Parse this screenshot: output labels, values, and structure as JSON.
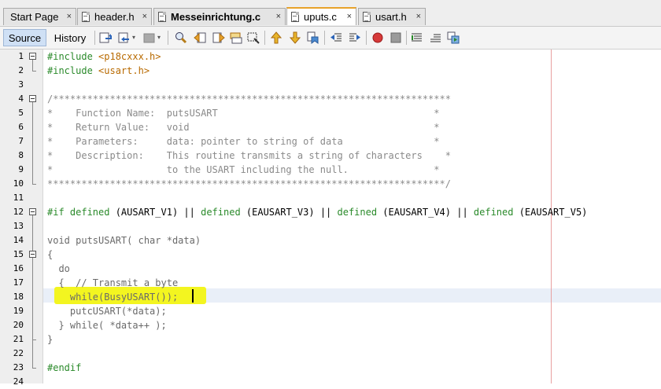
{
  "tabs": [
    {
      "label": "Start Page",
      "active": false,
      "bold": false,
      "icon": "start-page-icon"
    },
    {
      "label": "header.h",
      "active": false,
      "bold": false,
      "icon": "header-file-icon"
    },
    {
      "label": "Messeinrichtung.c",
      "active": false,
      "bold": true,
      "icon": "c-file-icon"
    },
    {
      "label": "uputs.c",
      "active": true,
      "bold": false,
      "icon": "c-file-icon"
    },
    {
      "label": "usart.h",
      "active": false,
      "bold": false,
      "icon": "header-file-icon"
    }
  ],
  "tab_close_glyph": "×",
  "toolbar": {
    "source_label": "Source",
    "history_label": "History",
    "icons": [
      "last-edit-icon",
      "back-icon",
      "forward-icon",
      "find-icon",
      "find-previous-icon",
      "find-next-icon",
      "find-selection-icon",
      "toggle-highlight-icon",
      "previous-bookmark-icon",
      "next-bookmark-icon",
      "toggle-bookmark-icon",
      "shift-left-icon",
      "shift-right-icon",
      "start-macro-icon",
      "stop-macro-icon",
      "comment-icon",
      "uncomment-icon",
      "run-icon"
    ]
  },
  "editor": {
    "line_numbers": [
      "1",
      "2",
      "3",
      "4",
      "5",
      "6",
      "7",
      "8",
      "9",
      "10",
      "11",
      "12",
      "13",
      "14",
      "15",
      "16",
      "17",
      "18",
      "19",
      "20",
      "21",
      "22",
      "23",
      "24"
    ],
    "lines": [
      [
        {
          "t": "#include ",
          "c": "pp"
        },
        {
          "t": "<p18cxxx.h>",
          "c": "str"
        }
      ],
      [
        {
          "t": "#include ",
          "c": "pp"
        },
        {
          "t": "<usart.h>",
          "c": "str"
        }
      ],
      [],
      [
        {
          "t": "/**********************************************************************",
          "c": "cm"
        }
      ],
      [
        {
          "t": "*    Function Name:  putsUSART                                      *",
          "c": "cm"
        }
      ],
      [
        {
          "t": "*    Return Value:   void                                           *",
          "c": "cm"
        }
      ],
      [
        {
          "t": "*    Parameters:     data: pointer to string of data                *",
          "c": "cm"
        }
      ],
      [
        {
          "t": "*    Description:    This routine transmits a string of characters    *",
          "c": "cm"
        }
      ],
      [
        {
          "t": "*                    to the USART including the null.               *",
          "c": "cm"
        }
      ],
      [
        {
          "t": "**********************************************************************/",
          "c": "cm"
        }
      ],
      [],
      [
        {
          "t": "#if ",
          "c": "pp"
        },
        {
          "t": "defined ",
          "c": "kw"
        },
        {
          "t": "(AUSART_V1) ",
          "c": "plain"
        },
        {
          "t": "|| ",
          "c": "plain"
        },
        {
          "t": "defined ",
          "c": "kw"
        },
        {
          "t": "(EAUSART_V3) ",
          "c": "plain"
        },
        {
          "t": "|| ",
          "c": "plain"
        },
        {
          "t": "defined ",
          "c": "kw"
        },
        {
          "t": "(EAUSART_V4) ",
          "c": "plain"
        },
        {
          "t": "|| ",
          "c": "plain"
        },
        {
          "t": "defined ",
          "c": "kw"
        },
        {
          "t": "(EAUSART_V5)",
          "c": "plain"
        }
      ],
      [],
      [
        {
          "t": "void putsUSART( char *data)",
          "c": "gray"
        }
      ],
      [
        {
          "t": "{",
          "c": "gray"
        }
      ],
      [
        {
          "t": "  do",
          "c": "gray"
        }
      ],
      [
        {
          "t": "  {  // Transmit a byte",
          "c": "gray"
        }
      ],
      [
        {
          "t": "    while(BusyUSART());",
          "c": "gray"
        }
      ],
      [
        {
          "t": "    putcUSART(*data);",
          "c": "gray"
        }
      ],
      [
        {
          "t": "  } while( *data++ );",
          "c": "gray"
        }
      ],
      [
        {
          "t": "}",
          "c": "gray"
        }
      ],
      [],
      [
        {
          "t": "#endif",
          "c": "pp"
        }
      ],
      []
    ],
    "current_line": 18
  },
  "colors": {
    "preprocessor": "#2a8a2a",
    "include_path": "#b86a00",
    "comment": "#8a8a8a",
    "inactive_code": "#6a6a6a",
    "highlight": "#f3f520",
    "active_tab_accent": "#e8a22a",
    "right_margin": "#e8a0a0"
  }
}
